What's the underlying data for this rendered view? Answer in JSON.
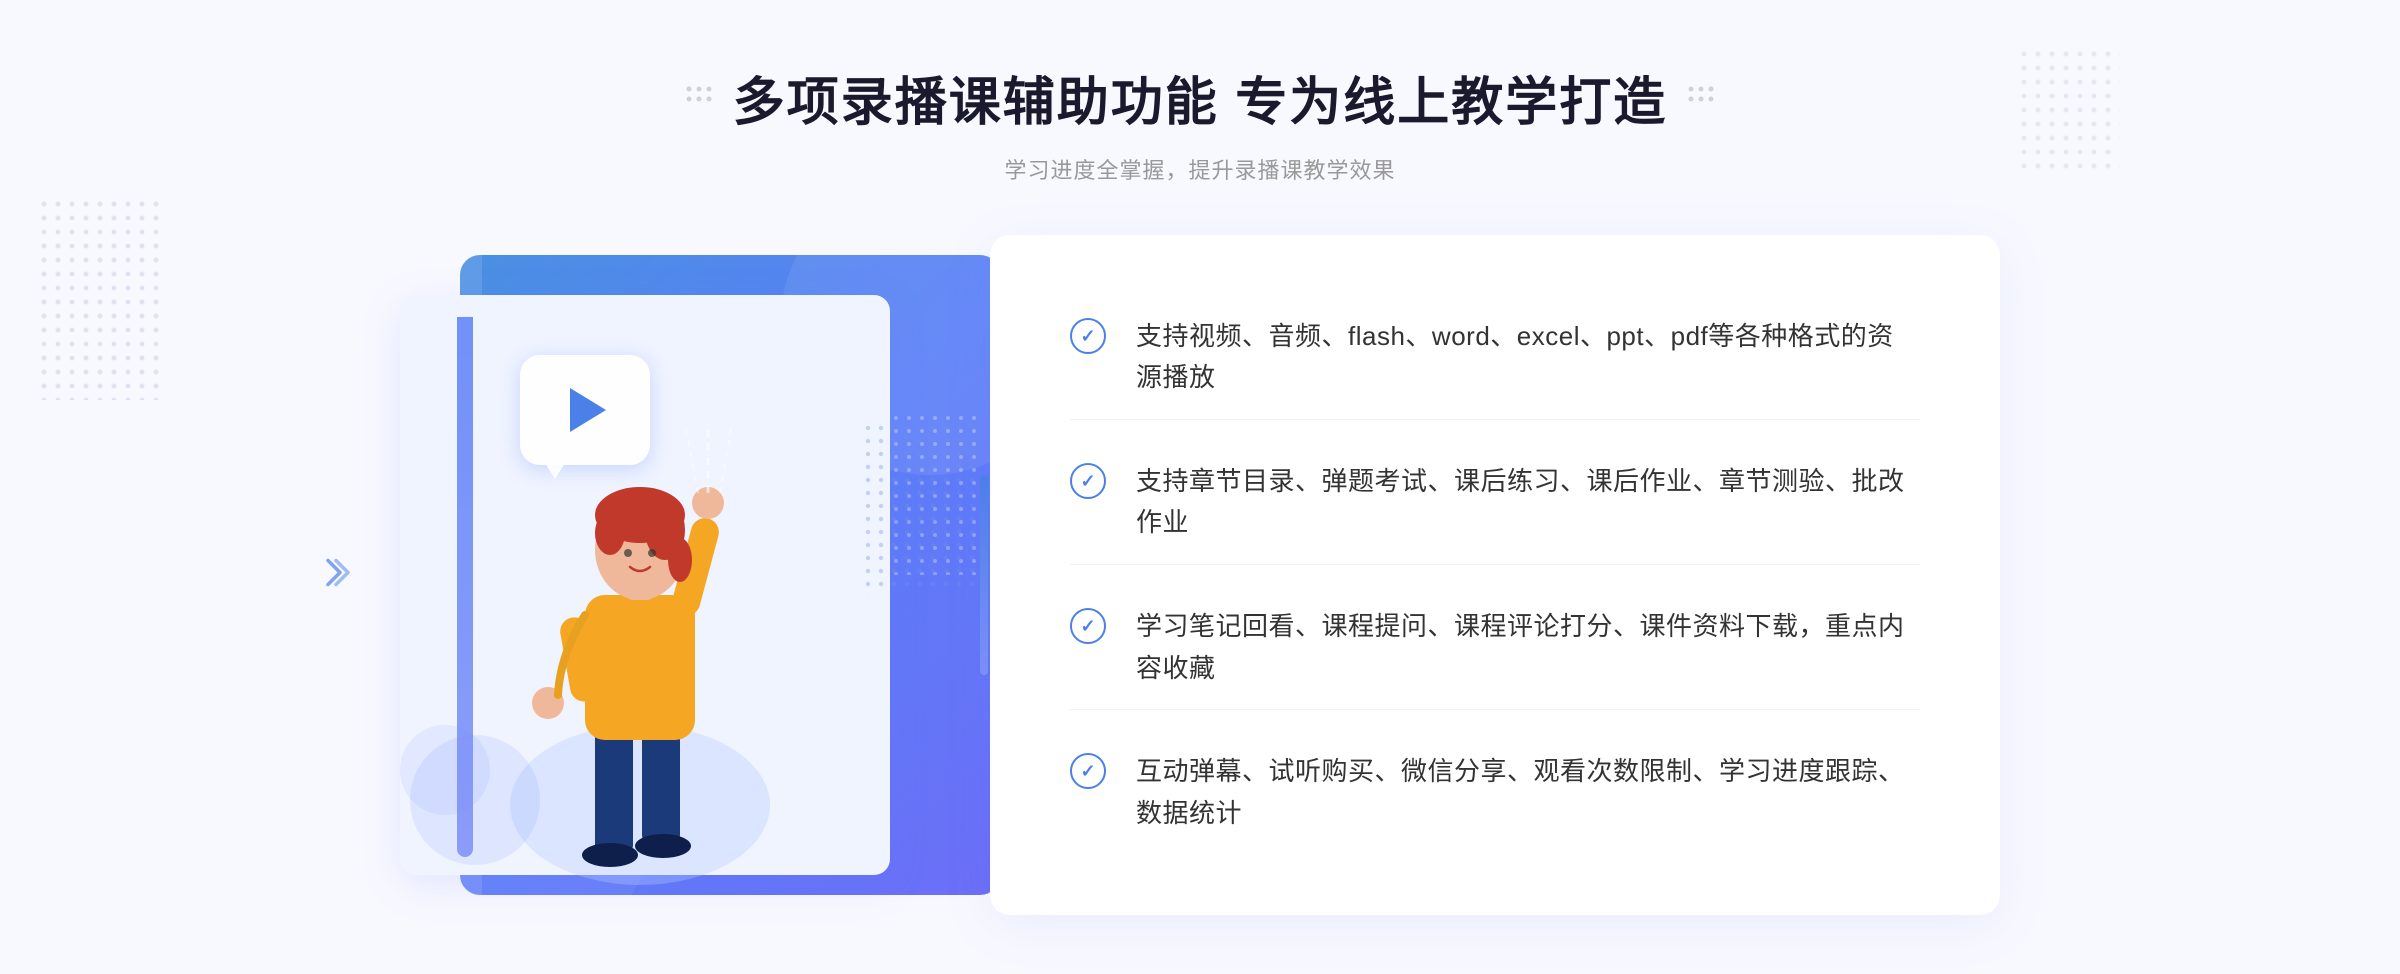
{
  "page": {
    "background_color": "#f8f9ff"
  },
  "header": {
    "title": "多项录播课辅助功能 专为线上教学打造",
    "subtitle": "学习进度全掌握，提升录播课教学效果",
    "dots_icon_left": "decorative-dots-left",
    "dots_icon_right": "decorative-dots-right"
  },
  "features": [
    {
      "id": 1,
      "text": "支持视频、音频、flash、word、excel、ppt、pdf等各种格式的资源播放"
    },
    {
      "id": 2,
      "text": "支持章节目录、弹题考试、课后练习、课后作业、章节测验、批改作业"
    },
    {
      "id": 3,
      "text": "学习笔记回看、课程提问、课程评论打分、课件资料下载，重点内容收藏"
    },
    {
      "id": 4,
      "text": "互动弹幕、试听购买、微信分享、观看次数限制、学习进度跟踪、数据统计"
    }
  ],
  "illustration": {
    "play_button_aria": "视频播放按钮",
    "character_aria": "教学人物插图"
  },
  "colors": {
    "accent_blue": "#4a80e8",
    "gradient_start": "#4a90e2",
    "gradient_end": "#6c6ef7",
    "text_dark": "#1a1a2e",
    "text_medium": "#333333",
    "text_light": "#999999",
    "check_color": "#4a80e8"
  }
}
